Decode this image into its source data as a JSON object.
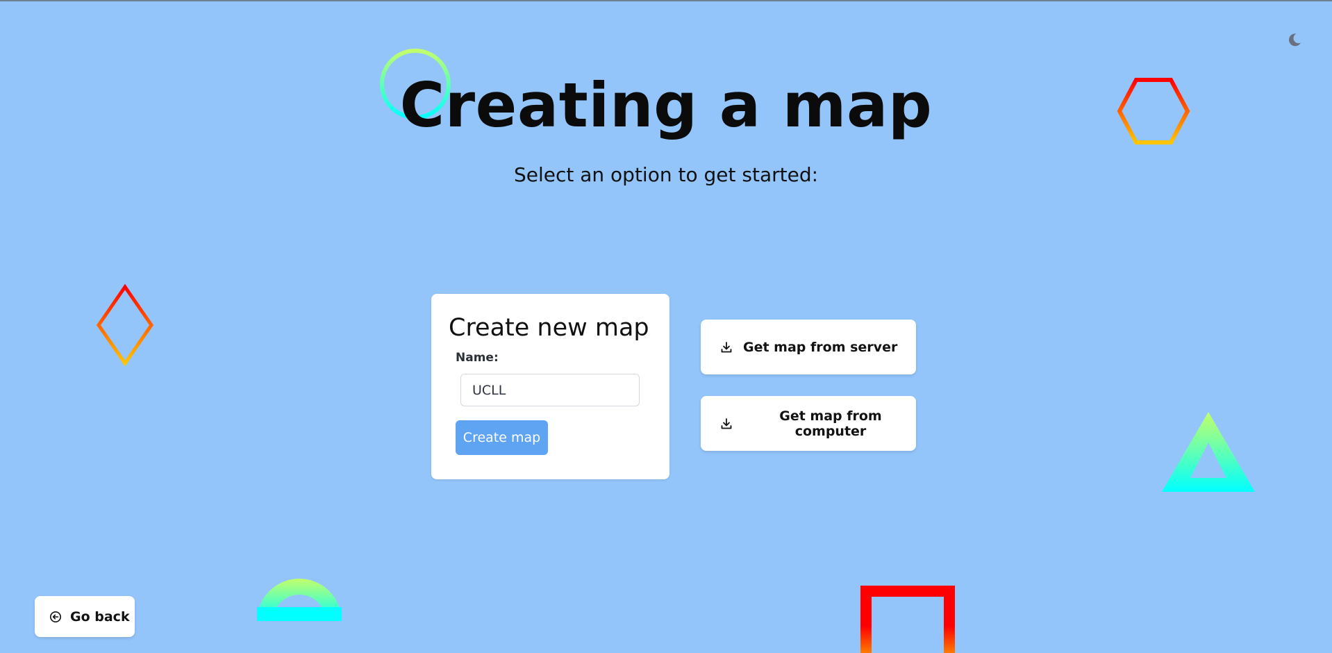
{
  "header": {
    "title": "Creating a map",
    "subtitle": "Select an option to get started:"
  },
  "theme_toggle": {
    "icon": "moon-icon"
  },
  "create_card": {
    "title": "Create new map",
    "name_label": "Name:",
    "name_value": "UCLL",
    "submit_label": "Create map"
  },
  "actions": {
    "server_label": "Get map from server",
    "computer_label": "Get map from computer",
    "icon": "download-icon"
  },
  "footer": {
    "back_label": "Go back",
    "back_icon": "circle-arrow-left-icon"
  },
  "colors": {
    "background": "#93c5fb",
    "accent": "#5ea4f3",
    "card": "#ffffff"
  },
  "decorations": [
    "circle",
    "hexagon",
    "diamond",
    "triangle",
    "semicircle",
    "square"
  ]
}
